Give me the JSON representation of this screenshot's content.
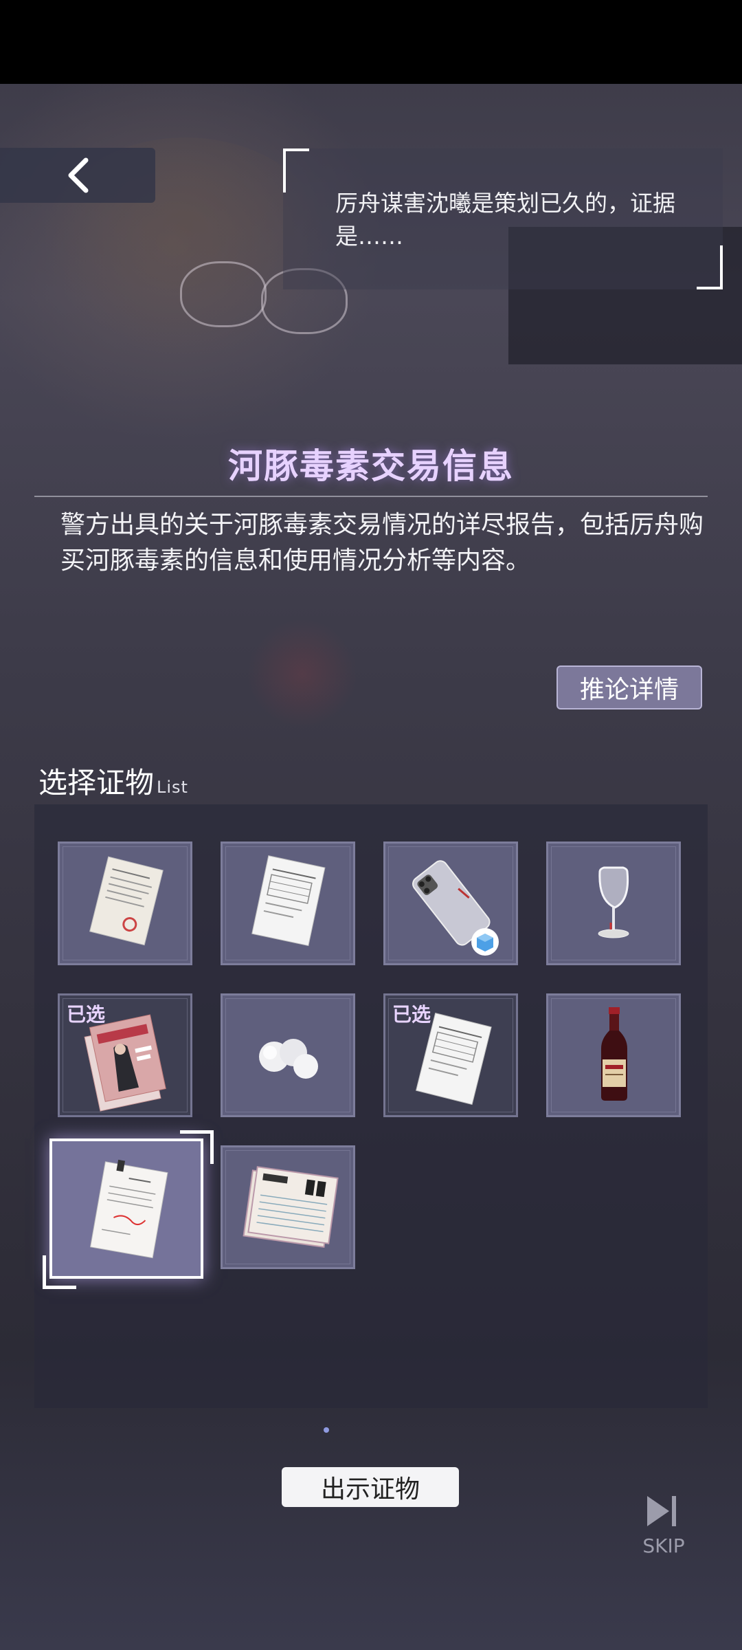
{
  "navigation": {
    "back_label": "back"
  },
  "dialog": {
    "text": "厉舟谋害沈曦是策划已久的，证据是……"
  },
  "evidence": {
    "title": "河豚毒素交易信息",
    "description": "警方出具的关于河豚毒素交易情况的详尽报告，包括厉舟购买河豚毒素的信息和使用情况分析等内容。",
    "detail_button": "推论详情"
  },
  "selection": {
    "label": "选择证物",
    "sublabel": "List",
    "selected_badge": "已选",
    "items": [
      {
        "icon": "letter-document-icon",
        "selected": false
      },
      {
        "icon": "report-01-icon",
        "selected": false
      },
      {
        "icon": "smartphone-icon",
        "selected": false
      },
      {
        "icon": "wine-glass-icon",
        "selected": false
      },
      {
        "icon": "magazine-icon",
        "selected": true
      },
      {
        "icon": "cotton-balls-icon",
        "selected": true
      },
      {
        "icon": "report-02-icon",
        "selected": true
      },
      {
        "icon": "wine-bottle-icon",
        "selected": false
      },
      {
        "icon": "transaction-record-icon",
        "selected": false,
        "focused": true
      },
      {
        "icon": "phone-records-icon",
        "selected": false
      }
    ]
  },
  "actions": {
    "show_evidence": "出示证物",
    "skip": "SKIP"
  },
  "colors": {
    "title": "#e7d2ff",
    "badge": "#e8d4ff",
    "accent_button": "#7c789a"
  }
}
